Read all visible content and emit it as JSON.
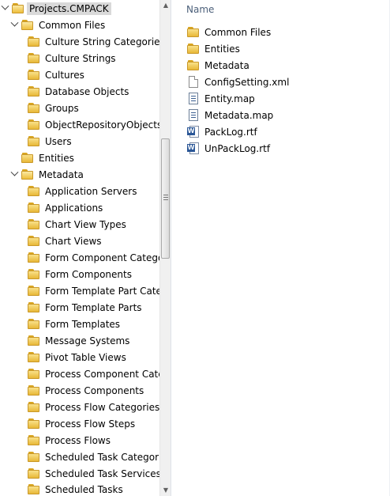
{
  "tree": {
    "root": "Projects.CMPACK",
    "common_files": {
      "label": "Common Files",
      "children": [
        "Culture String Categories",
        "Culture Strings",
        "Cultures",
        "Database Objects",
        "Groups",
        "ObjectRepositoryObjects",
        "Users"
      ]
    },
    "entities": "Entities",
    "metadata": {
      "label": "Metadata",
      "children": [
        "Application Servers",
        "Applications",
        "Chart View Types",
        "Chart Views",
        "Form Component Categories",
        "Form Components",
        "Form Template Part Categories",
        "Form Template Parts",
        "Form Templates",
        "Message Systems",
        "Pivot Table Views",
        "Process Component Categories",
        "Process Components",
        "Process Flow Categories",
        "Process Flow Steps",
        "Process Flows",
        "Scheduled Task Categories",
        "Scheduled Task Services",
        "Scheduled Tasks"
      ]
    }
  },
  "list": {
    "column_header": "Name",
    "items": [
      {
        "name": "Common Files",
        "type": "folder-icon"
      },
      {
        "name": "Entities",
        "type": "folder-icon"
      },
      {
        "name": "Metadata",
        "type": "folder-icon"
      },
      {
        "name": "ConfigSetting.xml",
        "type": "xml-file-icon"
      },
      {
        "name": "Entity.map",
        "type": "map-file-icon"
      },
      {
        "name": "Metadata.map",
        "type": "map-file-icon"
      },
      {
        "name": "PackLog.rtf",
        "type": "word-doc-icon"
      },
      {
        "name": "UnPackLog.rtf",
        "type": "word-doc-icon"
      }
    ]
  },
  "colors": {
    "selection": "#d9d9d9",
    "header_text": "#4c607a",
    "folder": "#e8b837"
  }
}
